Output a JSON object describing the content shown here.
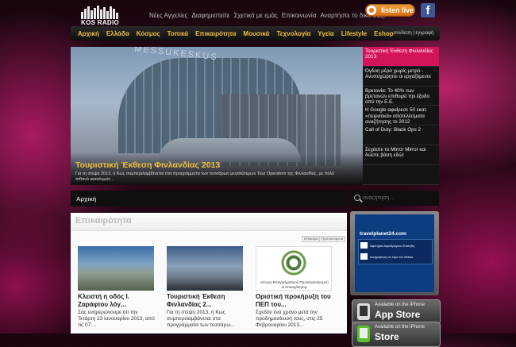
{
  "header": {
    "logo_text": "KOS RADIO",
    "top_links": [
      "Νέες Αγγελίες",
      "Διαφημιστείτε",
      "Σχετικά με εμάς",
      "Επικοινωνία",
      "Αναρτήστε το δικό σας!"
    ],
    "listen_label": "listen live",
    "facebook_glyph": "f"
  },
  "nav": {
    "items": [
      "Αρχική",
      "Ελλάδα",
      "Κόσμος",
      "Τοπικά",
      "Επικαιρότητα",
      "Μουσικά",
      "Τεχνολογία",
      "Υγεία",
      "Lifestyle",
      "Eshop"
    ],
    "login": "σύνδεση | εγγραφή"
  },
  "slider": {
    "building_sign": "MESSUKESKUS",
    "caption": "Τουριστική Έκθεση Φινλανδίας 2013",
    "summary": "Για τη στεψη 2013, η Κως συμπεριλαμβάνεται στα προγράμματα των τεσσάρων μεγαλύτερων Tour Operators της Φινλανδίας, με πολύ πιθανό καταλυμάτ...",
    "side_items": [
      "Τουριστική Έκθεση Φινλανδίας 2013",
      "Όγδοη μέρα χωρίς μετρό - Ανυποχώρητοι οι εργαζόμενοι",
      "Βρετανία: Το 40% των βρετανών επιθυμεί την έξοδο από την Ε.Ε.",
      "Η Google αφαίρεσε 50 εκατ. «πειρατικά» αποτελέσματα αναζήτησης το 2012",
      "Call of Duty: Black Ops 2",
      "Σεχάστε το Mirror Mirror και δώστε βάση εδώ!"
    ],
    "active_index": 0
  },
  "breadcrumb": "Αρχική",
  "search": {
    "placeholder": "αναζήτηση..."
  },
  "main": {
    "heading": "Επικαιρότητα",
    "sort_labels": [
      "Επίκαιρα",
      "Προτεινόμενα"
    ],
    "cards": [
      {
        "title": "Κλειστή η οδός Ι. Ζαράφτου λόγ...",
        "desc": "Σας ενημερώνουμε ότι την Τετάρτη 23 Ιανουαρίου 2013, από τις 07:..."
      },
      {
        "title": "Τουριστική Έκθεση Φινλανδίας 2...",
        "desc": "Για τη στεψη 2013, η Κως συμπεριλαμβάνεται στα προγράμματα των τεσσάρω..."
      },
      {
        "title": "Οριστική προκήρυξη του ΠΕΠ του...",
        "desc": "Σχεδόν ένα χρόνο μετά την προδημοσίευσή τους, στις 25 Φεβρουαρίου 2013..."
      }
    ],
    "card3_org": "Κέντρο Επαγγελματικού Προσανατολισμού & Απασχόλησης"
  },
  "ads": {
    "travel_url": "travelplanet24.com",
    "sign_lines": [
      "Αφετηρία Αεροδρομιού Επιτήδη",
      "Αναχώρηση σε λίγο του Airbus"
    ],
    "store1": {
      "top": "Available on the iPhone",
      "main": "App Store"
    },
    "store2": {
      "top": "Available on the iPhone",
      "main": "Store"
    }
  },
  "colors": {
    "accent": "#f0c040",
    "active": "#d4145a",
    "listen": "#e8841c"
  }
}
